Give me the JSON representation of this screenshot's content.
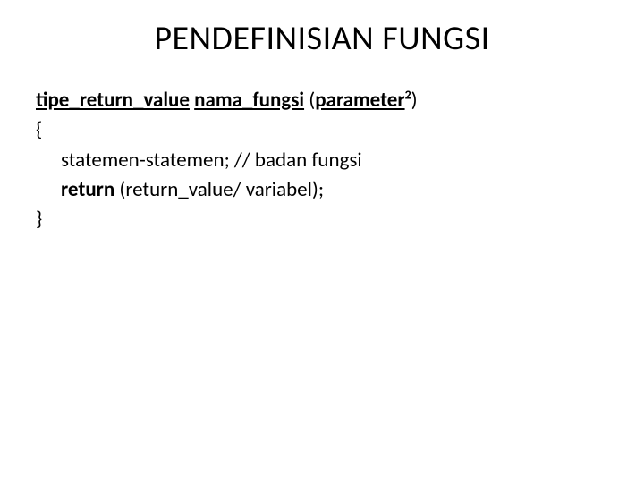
{
  "title": "PENDEFINISIAN FUNGSI",
  "syntax": {
    "return_type": "tipe_return_value",
    "space1": "  ",
    "func_name": "nama_fungsi",
    "space2": " ",
    "paren_open": "(",
    "param_word": "parameter",
    "param_sup": "2",
    "paren_close": ")",
    "brace_open": "{",
    "line_statements": "statemen-statemen;    // badan fungsi",
    "return_kw": "return",
    "return_rest": " (return_value/ variabel);",
    "brace_close": "}"
  }
}
